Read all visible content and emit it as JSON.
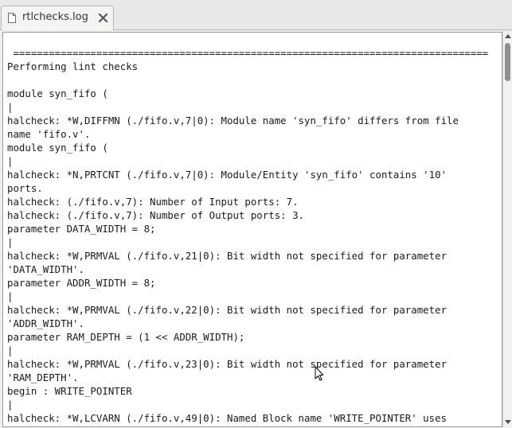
{
  "tab": {
    "title": "rtlchecks.log",
    "icon": "text-file-icon",
    "close_icon": "close-icon"
  },
  "log": {
    "lines": [
      " ================================================================================",
      "Performing lint checks",
      "",
      "module syn_fifo (",
      "|",
      "halcheck: *W,DIFFMN (./fifo.v,7|0): Module name 'syn_fifo' differs from file",
      "name 'fifo.v'.",
      "module syn_fifo (",
      "|",
      "halcheck: *N,PRTCNT (./fifo.v,7|0): Module/Entity 'syn_fifo' contains '10'",
      "ports.",
      "halcheck: (./fifo.v,7): Number of Input ports: 7.",
      "halcheck: (./fifo.v,7): Number of Output ports: 3.",
      "parameter DATA_WIDTH = 8;",
      "|",
      "halcheck: *W,PRMVAL (./fifo.v,21|0): Bit width not specified for parameter",
      "'DATA_WIDTH'.",
      "parameter ADDR_WIDTH = 8;",
      "|",
      "halcheck: *W,PRMVAL (./fifo.v,22|0): Bit width not specified for parameter",
      "'ADDR_WIDTH'.",
      "parameter RAM_DEPTH = (1 << ADDR_WIDTH);",
      "|",
      "halcheck: *W,PRMVAL (./fifo.v,23|0): Bit width not specified for parameter",
      "'RAM_DEPTH'.",
      "begin : WRITE_POINTER",
      "|",
      "halcheck: *W,LCVARN (./fifo.v,49|0): Named Block name 'WRITE_POINTER' uses"
    ]
  },
  "scrollbar": {
    "up_icon": "scroll-up-arrow-icon",
    "down_icon": "scroll-down-arrow-icon"
  },
  "pointer": "text-cursor-icon"
}
